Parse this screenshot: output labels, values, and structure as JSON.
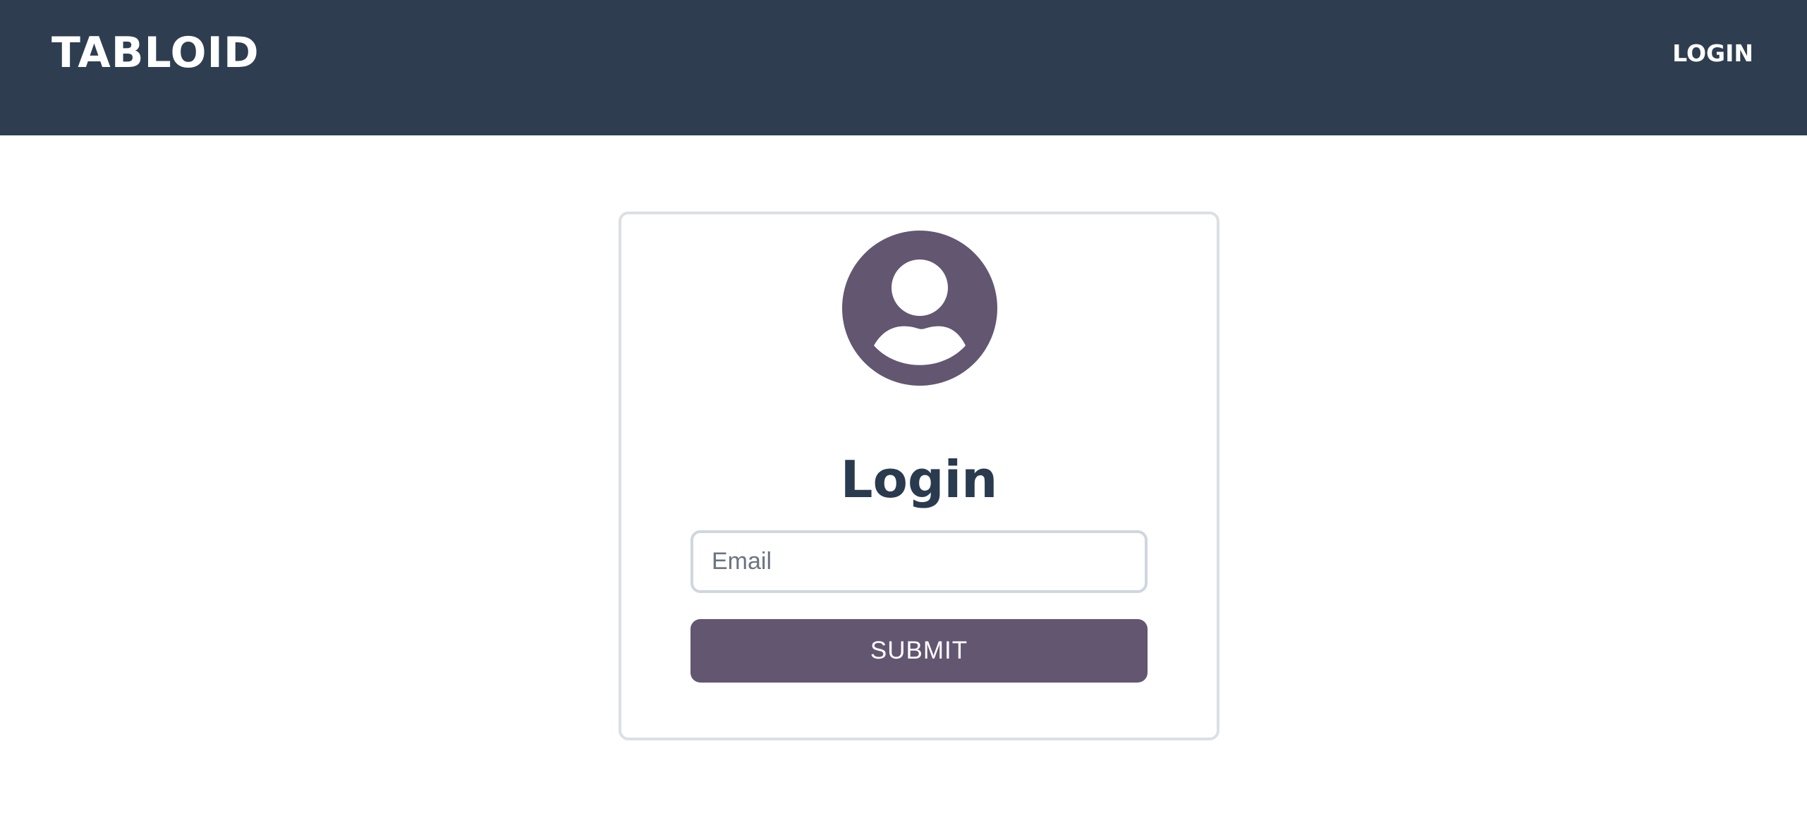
{
  "navbar": {
    "brand": "TABLOID",
    "login_link": "LOGIN"
  },
  "login_card": {
    "avatar_icon": "user-avatar-icon",
    "title": "Login",
    "email": {
      "placeholder": "Email",
      "value": ""
    },
    "submit_label": "SUBMIT"
  },
  "colors": {
    "navbar_bg": "#2e3e50",
    "accent": "#625671",
    "title_text": "#2a3a4f",
    "card_border": "#dcdfe3"
  }
}
